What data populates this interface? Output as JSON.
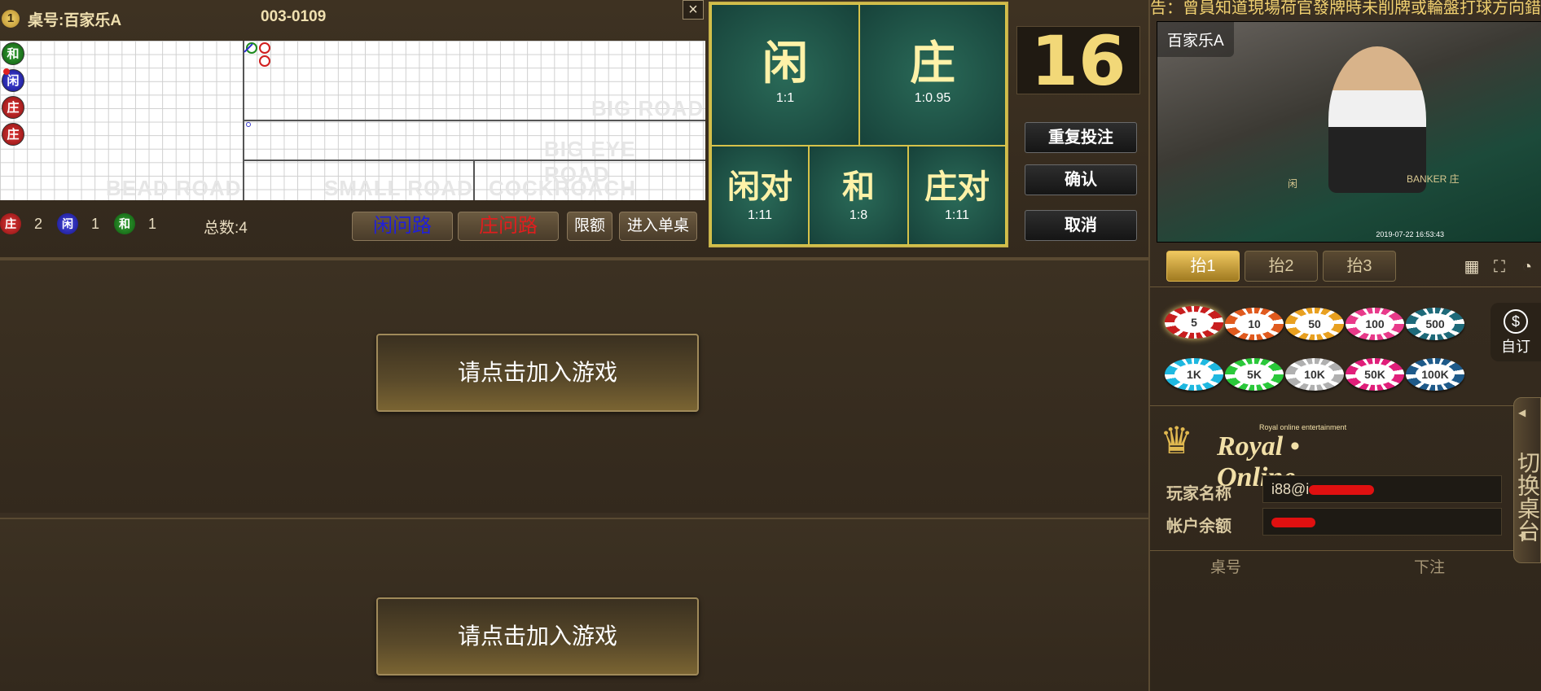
{
  "table": {
    "number_badge": "1",
    "name": "桌号:百家乐A",
    "game_id": "003-0109",
    "close_label": "×"
  },
  "roadmap": {
    "labels": {
      "bead": "BEAD ROAD",
      "big": "BIG ROAD",
      "big_eye": "BIG EYE ROAD",
      "small": "SMALL ROAD",
      "cockroach": "COCKROACH ROAD"
    },
    "bead_results": [
      "和",
      "闲",
      "庄",
      "庄"
    ]
  },
  "stats": {
    "banker_label": "庄",
    "banker_count": "2",
    "player_label": "闲",
    "player_count": "1",
    "tie_label": "和",
    "tie_count": "1",
    "total": "总数:4"
  },
  "buttons": {
    "player_ask": "闲问路",
    "banker_ask": "庄问路",
    "limit": "限额",
    "enter_single": "进入单桌"
  },
  "bet_board": {
    "player": {
      "label": "闲",
      "odds": "1:1"
    },
    "banker": {
      "label": "庄",
      "odds": "1:0.95"
    },
    "player_pair": {
      "label": "闲对",
      "odds": "1:11"
    },
    "tie": {
      "label": "和",
      "odds": "1:8"
    },
    "banker_pair": {
      "label": "庄对",
      "odds": "1:11"
    }
  },
  "countdown": "16",
  "actions": {
    "repeat": "重复投注",
    "confirm": "确认",
    "cancel": "取消"
  },
  "join": {
    "label_1": "请点击加入游戏",
    "label_2": "请点击加入游戏"
  },
  "right": {
    "ticker": "告：曾員知道現場荷官發牌時未削牌或輪盤打球方向錯",
    "video_title": "百家乐A",
    "video_table_player": "闲",
    "video_table_banker": "BANKER 庄",
    "video_timestamp": "2019-07-22 16:53:43",
    "tabs": [
      "抬1",
      "抬2",
      "抬3"
    ],
    "chips_row1": [
      "5",
      "10",
      "50",
      "100",
      "500"
    ],
    "chips_row2": [
      "1K",
      "5K",
      "10K",
      "50K",
      "100K"
    ],
    "custom_chip": "自订",
    "logo_main": "Royal • Online",
    "logo_sub": "Royal online entertainment",
    "player_name_label": "玩家名称",
    "player_name_value": "i88@i",
    "balance_label": "帐户余额",
    "switch_table": "切换桌台",
    "list_col_table": "桌号",
    "list_col_bet": "下注"
  },
  "colors": {
    "banker": "#c81e1e",
    "player": "#1e1ec8",
    "tie": "#1e8a1e",
    "gold": "#f2d878",
    "felt": "#1e4a3e"
  }
}
